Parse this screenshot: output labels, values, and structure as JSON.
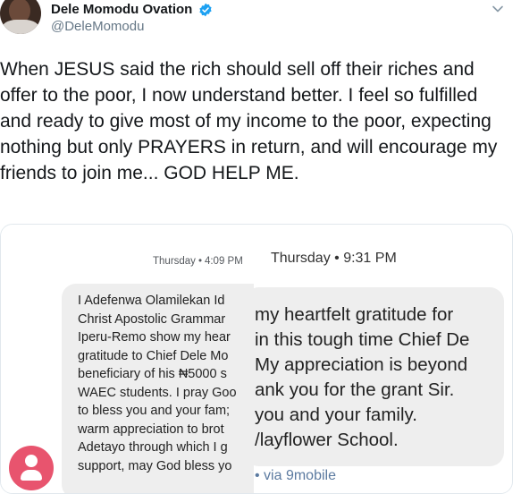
{
  "tweet": {
    "author_name": "Dele Momodu Ovation",
    "handle": "@DeleMomodu",
    "verified_icon": "verified-badge-icon",
    "menu_icon": "chevron-down-icon",
    "text": "When JESUS said the rich should sell off their riches and offer to the poor, I now understand better. I feel so fulfilled and ready to give most of my income to the poor, expecting nothing but only PRAYERS in return, and will encourage my friends to join me... GOD HELP ME.",
    "accent_color": "#1da1f2"
  },
  "left_screenshot": {
    "timestamp_day": "Thursday",
    "timestamp_sep": "•",
    "timestamp_time": "4:09 PM",
    "message_lines": [
      "I Adefenwa Olamilekan Id",
      "Christ Apostolic Grammar",
      "Iperu-Remo show my hear",
      "gratitude to Chief Dele Mo",
      "beneficiary of his ₦5000 s",
      "WAEC students. I pray Goo",
      "to bless you and your fam;",
      "warm appreciation to brot",
      "Adetayo through which I g",
      "support, may God bless yo"
    ],
    "contact_icon": "person-icon",
    "contact_color": "#e8546e"
  },
  "right_screenshot": {
    "timestamp": "Thursday • 9:31 PM",
    "message_lines": [
      "my heartfelt gratitude for",
      "in this tough time Chief De",
      " My appreciation is beyond",
      "ank you for the grant Sir.",
      " you and your family.",
      "/layflower School."
    ],
    "via": "• via 9mobile"
  }
}
